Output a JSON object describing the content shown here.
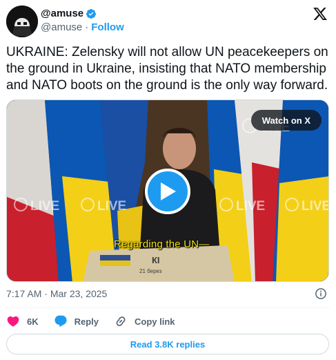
{
  "author": {
    "display_name": "@amuse",
    "handle": "@amuse",
    "separator": "·",
    "follow_label": "Follow"
  },
  "tweet": {
    "text": "UKRAINE: Zelensky will not allow UN peacekeepers on the ground in Ukraine, insisting that NATO membership and NATO boots on the ground is the only way forward."
  },
  "media": {
    "watch_label": "Watch on X",
    "subtitle": "Regarding the UN—",
    "live_badge": "LIVE",
    "podium_text": "КІ",
    "podium_subtext": "21 берез"
  },
  "meta": {
    "time": "7:17 AM",
    "separator": "·",
    "date": "Mar 23, 2025"
  },
  "actions": {
    "likes": "6K",
    "reply_label": "Reply",
    "copy_label": "Copy link"
  },
  "replies_button": "Read 3.8K replies",
  "colors": {
    "accent": "#1d9bf0",
    "like": "#f91880",
    "text": "#0f1419",
    "muted": "#536471"
  },
  "icons": [
    "verified-badge-icon",
    "x-logo-icon",
    "play-icon",
    "info-icon",
    "heart-icon",
    "reply-bubble-icon",
    "link-icon"
  ]
}
